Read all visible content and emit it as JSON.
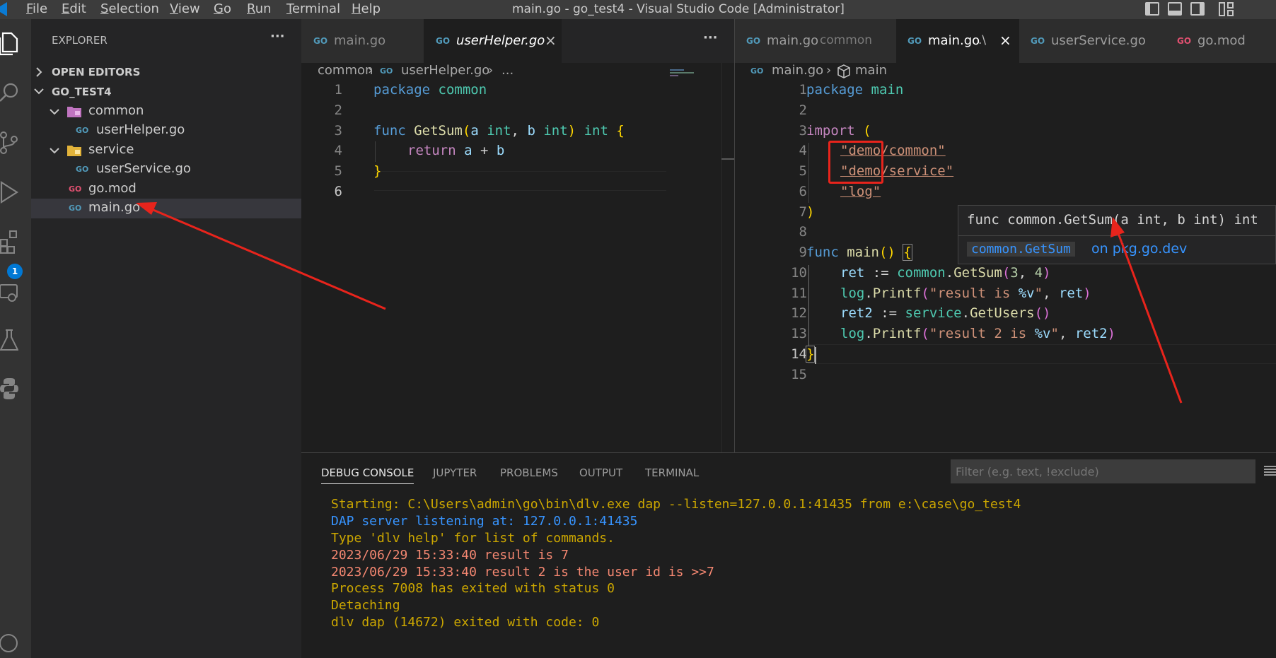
{
  "titlebar": {
    "menus": [
      "File",
      "Edit",
      "Selection",
      "View",
      "Go",
      "Run",
      "Terminal",
      "Help"
    ],
    "title": "main.go - go_test4 - Visual Studio Code [Administrator]"
  },
  "activitybar": {
    "extensions_badge": "1"
  },
  "sidebar": {
    "header": "EXPLORER",
    "more": "···",
    "open_editors": "OPEN EDITORS",
    "root": "GO_TEST4",
    "tree": [
      {
        "name": "common",
        "type": "folder"
      },
      {
        "name": "userHelper.go",
        "type": "go"
      },
      {
        "name": "service",
        "type": "folder"
      },
      {
        "name": "userService.go",
        "type": "go"
      },
      {
        "name": "go.mod",
        "type": "mod"
      },
      {
        "name": "main.go",
        "type": "go"
      }
    ],
    "go_label": "GO"
  },
  "left_editor": {
    "tabs": [
      {
        "name": "main.go",
        "active": false
      },
      {
        "name": "userHelper.go",
        "active": true
      }
    ],
    "more": "···",
    "breadcrumb": [
      "common",
      "userHelper.go",
      "..."
    ],
    "line_numbers": [
      "1",
      "2",
      "3",
      "4",
      "5",
      "6"
    ]
  },
  "right_editor": {
    "tabs": [
      {
        "name": "main.go",
        "desc": "common",
        "active": false
      },
      {
        "name": "main.go",
        "desc": ".\\",
        "active": true
      },
      {
        "name": "userService.go",
        "desc": "",
        "active": false
      },
      {
        "name": "go.mod",
        "desc": "",
        "active": false
      }
    ],
    "breadcrumb": [
      "main.go",
      "main"
    ],
    "line_numbers": [
      "1",
      "2",
      "3",
      "4",
      "5",
      "6",
      "7",
      "8",
      "9",
      "10",
      "11",
      "12",
      "13",
      "14",
      "15"
    ]
  },
  "hover": {
    "signature": "func common.GetSum(a int, b int) int",
    "link_code": "common.GetSum",
    "link_text": "on pkg.go.dev"
  },
  "panel": {
    "tabs": [
      "DEBUG CONSOLE",
      "JUPYTER",
      "PROBLEMS",
      "OUTPUT",
      "TERMINAL"
    ],
    "filter_placeholder": "Filter (e.g. text, !exclude)",
    "console": [
      {
        "text": "Starting: C:\\Users\\admin\\go\\bin\\dlv.exe dap --listen=127.0.0.1:41435 from e:\\case\\go_test4",
        "color": "#cca700"
      },
      {
        "text": "DAP server listening at: 127.0.0.1:41435",
        "color": "#3794ff"
      },
      {
        "text": "Type 'dlv help' for list of commands.",
        "color": "#cca700"
      },
      {
        "text": "2023/06/29 15:33:40 result is 7",
        "color": "#f48771"
      },
      {
        "text": "2023/06/29 15:33:40 result 2 is the user id is >>7",
        "color": "#f48771"
      },
      {
        "text": "Process 7008 has exited with status 0",
        "color": "#cca700"
      },
      {
        "text": "Detaching",
        "color": "#cca700"
      },
      {
        "text": "dlv dap (14672) exited with code: 0",
        "color": "#cca700"
      }
    ]
  },
  "code_left": {
    "l1": [
      "package",
      " common"
    ],
    "l3": [
      "func",
      " ",
      "GetSum",
      "(",
      "a",
      " ",
      "int",
      ", ",
      "b",
      " ",
      "int",
      ")",
      " ",
      "int",
      " ",
      "{"
    ],
    "l4": [
      "return",
      " ",
      "a",
      " + ",
      "b"
    ],
    "l5": [
      "}"
    ]
  },
  "code_right": {
    "l1": [
      "package",
      " main"
    ],
    "l3": [
      "import",
      " ",
      "("
    ],
    "l4": [
      "\"demo/common\""
    ],
    "l5": [
      "\"demo/service\""
    ],
    "l6": [
      "\"log\""
    ],
    "l7": [
      ")"
    ],
    "l9": [
      "func",
      " ",
      "main",
      "()",
      " ",
      "{"
    ],
    "l10": [
      "ret",
      " := ",
      "common",
      ".",
      "GetSum",
      "(",
      "3",
      ", ",
      "4",
      ")"
    ],
    "l11": [
      "log",
      ".",
      "Printf",
      "(",
      "\"result is ",
      "%v",
      "\"",
      ", ",
      "ret",
      ")"
    ],
    "l12": [
      "ret2",
      " := ",
      "service",
      ".",
      "GetUsers",
      "()"
    ],
    "l13": [
      "log",
      ".",
      "Printf",
      "(",
      "\"result 2 is ",
      "%v",
      "\"",
      ", ",
      "ret2",
      ")"
    ],
    "l14": [
      "}"
    ]
  }
}
